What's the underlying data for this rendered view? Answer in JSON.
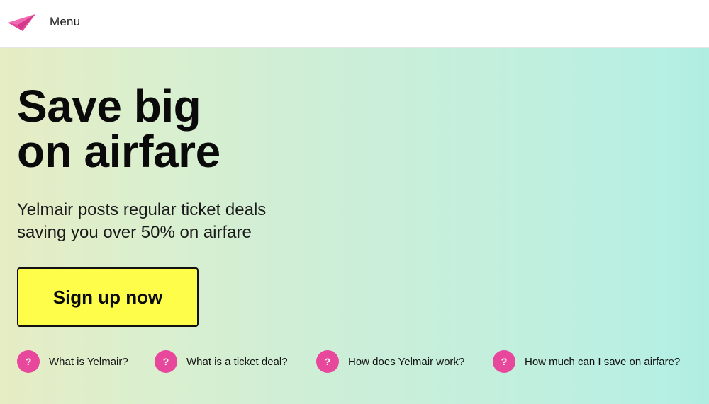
{
  "nav": {
    "logo_icon": "paper-plane-icon",
    "menu_label": "Menu",
    "brand_color": "#e8489c"
  },
  "hero": {
    "headline_line1": "Save big",
    "headline_line2": "on airfare",
    "subhead_line1": "Yelmair posts regular ticket deals",
    "subhead_line2": "saving you over 50% on airfare",
    "cta_label": "Sign up now",
    "cta_color": "#fefe4a"
  },
  "faqs": [
    {
      "icon": "?",
      "label": "What is Yelmair?"
    },
    {
      "icon": "?",
      "label": "What is a ticket deal?"
    },
    {
      "icon": "?",
      "label": "How does Yelmair work?"
    },
    {
      "icon": "?",
      "label": "How much can I save on airfare?"
    }
  ]
}
